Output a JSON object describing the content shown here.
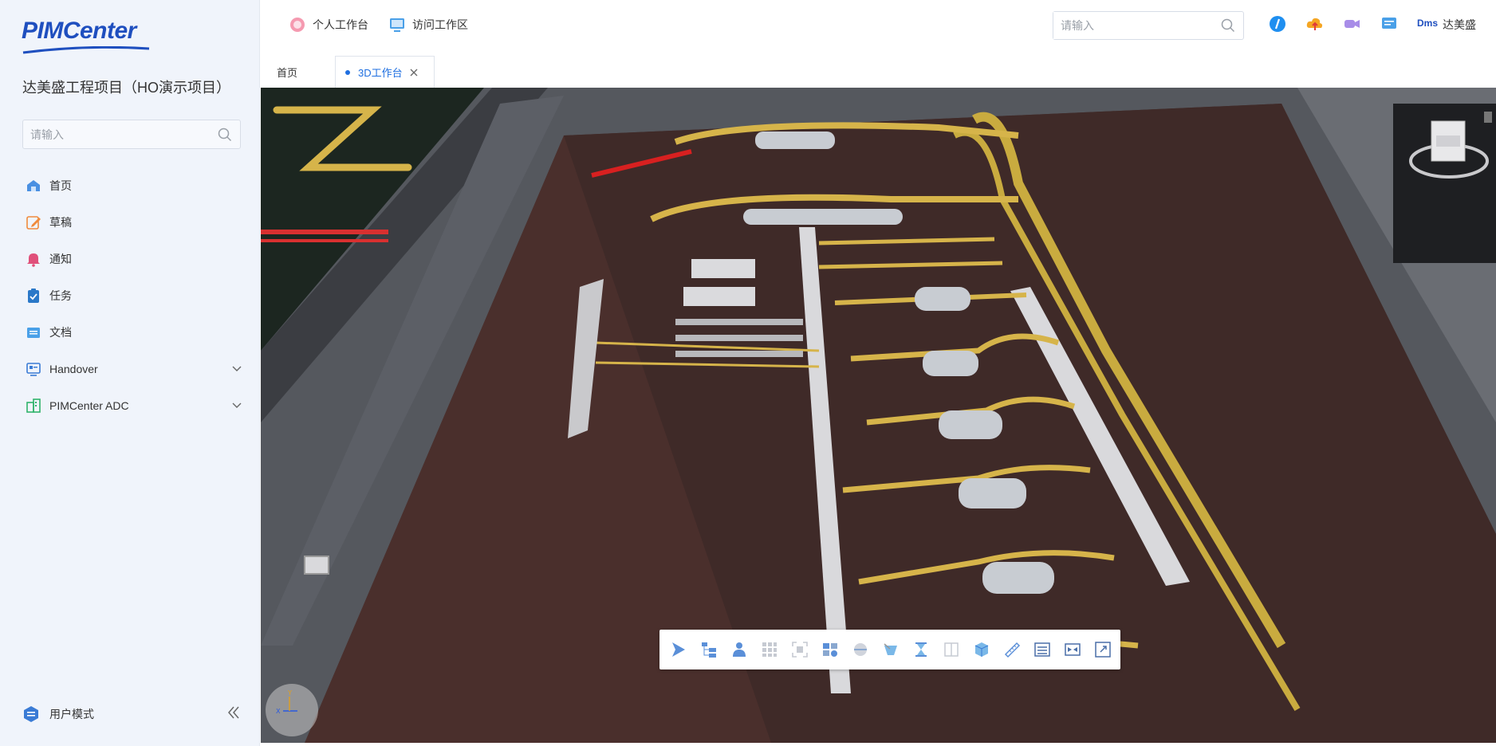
{
  "app": {
    "logo_text": "PIMCenter",
    "project_title": "达美盛工程项目（HO演示项目）",
    "brand_color": "#1f4fbf",
    "accent_color": "#1f6fe0"
  },
  "sidebar": {
    "search": {
      "placeholder": "请输入",
      "icon": "search-icon"
    },
    "items": [
      {
        "label": "首页",
        "icon": "home-icon",
        "expandable": false
      },
      {
        "label": "草稿",
        "icon": "edit-icon",
        "expandable": false
      },
      {
        "label": "通知",
        "icon": "bell-icon",
        "expandable": false
      },
      {
        "label": "任务",
        "icon": "clipboard-icon",
        "expandable": false
      },
      {
        "label": "文档",
        "icon": "folder-icon",
        "expandable": false
      },
      {
        "label": "Handover",
        "icon": "handover-icon",
        "expandable": true
      },
      {
        "label": "PIMCenter ADC",
        "icon": "building-icon",
        "expandable": true
      }
    ],
    "footer": {
      "user_mode_label": "用户模式",
      "collapse_icon": "double-chevron-left-icon"
    }
  },
  "header": {
    "nav": [
      {
        "label": "个人工作台",
        "icon": "personal-workbench-icon"
      },
      {
        "label": "访问工作区",
        "icon": "monitor-icon"
      }
    ],
    "search": {
      "placeholder": "请输入",
      "icon": "search-icon"
    },
    "icons": [
      "compass-icon",
      "cloud-upload-icon",
      "video-icon",
      "message-icon"
    ],
    "dms_label": "Dms",
    "username": "达美盛"
  },
  "tabs": [
    {
      "label": "首页",
      "active": false
    },
    {
      "label": "3D工作台",
      "active": true,
      "closable": true
    }
  ],
  "viewport": {
    "toolbar": [
      "select-icon",
      "model-tree-icon",
      "user-view-icon",
      "grid-icon",
      "focus-icon",
      "properties-icon",
      "section-icon",
      "clip-icon",
      "hourglass-icon",
      "split-icon",
      "cube-icon",
      "measure-icon",
      "list-icon",
      "compare-icon",
      "fullscreen-icon"
    ],
    "top_icons": [
      "restore-view-icon",
      "play-icon"
    ],
    "compass_axes": {
      "x": "X",
      "y": "Y"
    }
  }
}
